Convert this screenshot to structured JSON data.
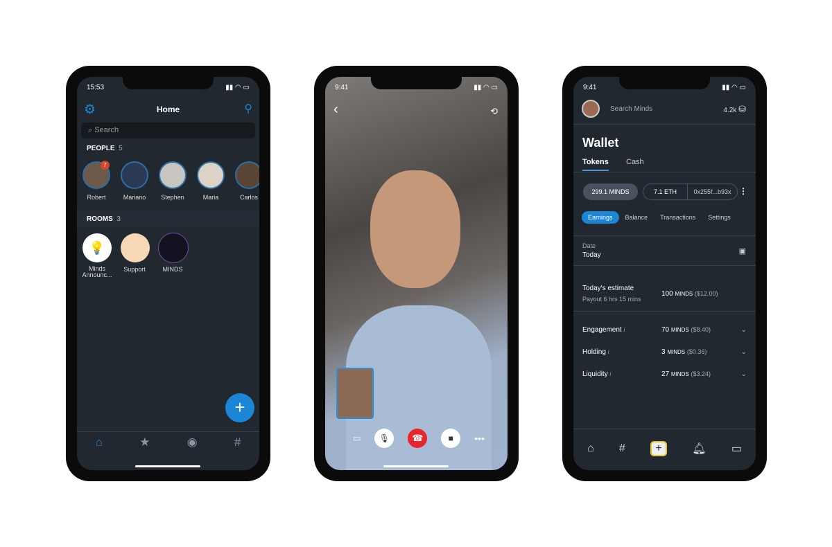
{
  "home": {
    "time": "15:53",
    "title": "Home",
    "search_placeholder": "Search",
    "people_label": "PEOPLE",
    "people_count": "5",
    "people": [
      {
        "name": "Robert",
        "badge": "7"
      },
      {
        "name": "Mariano"
      },
      {
        "name": "Stephen"
      },
      {
        "name": "Maria"
      },
      {
        "name": "Carlos"
      }
    ],
    "rooms_label": "ROOMS",
    "rooms_count": "3",
    "rooms": [
      {
        "name": "Minds Announc..."
      },
      {
        "name": "Support"
      },
      {
        "name": "MINDS"
      }
    ],
    "fab": "+",
    "nav": [
      "home-icon",
      "star-icon",
      "profile-icon",
      "hashtag-icon"
    ],
    "accent": "#1b85d6"
  },
  "call": {
    "time": "9:41",
    "controls": [
      "pip-icon",
      "microphone-icon",
      "hang-up-icon",
      "video-icon",
      "more-icon"
    ],
    "hangup_color": "#e8242c"
  },
  "wallet": {
    "time": "9:41",
    "search": "Search Minds",
    "token_count": "4.2k",
    "title": "Wallet",
    "tabs": [
      "Tokens",
      "Cash"
    ],
    "minds_balance": "299.1 MINDS",
    "eth_balance": "7.1 ETH",
    "address": "0x255f...b93x",
    "subtabs": [
      "Earnings",
      "Balance",
      "Transactions",
      "Settings"
    ],
    "date_label": "Date",
    "date_value": "Today",
    "estimate_label": "Today's estimate",
    "payout": "Payout 6 hrs 15 mins",
    "estimate_amount": "100",
    "estimate_unit": "MINDS",
    "estimate_usd": "($12.00)",
    "rows": [
      {
        "label": "Engagement",
        "amount": "70",
        "unit": "MINDS",
        "usd": "($8.40)"
      },
      {
        "label": "Holding",
        "amount": "3",
        "unit": "MINDS",
        "usd": "($0.36)"
      },
      {
        "label": "Liquidity",
        "amount": "27",
        "unit": "MINDS",
        "usd": "($3.24)"
      }
    ],
    "info": "i"
  }
}
